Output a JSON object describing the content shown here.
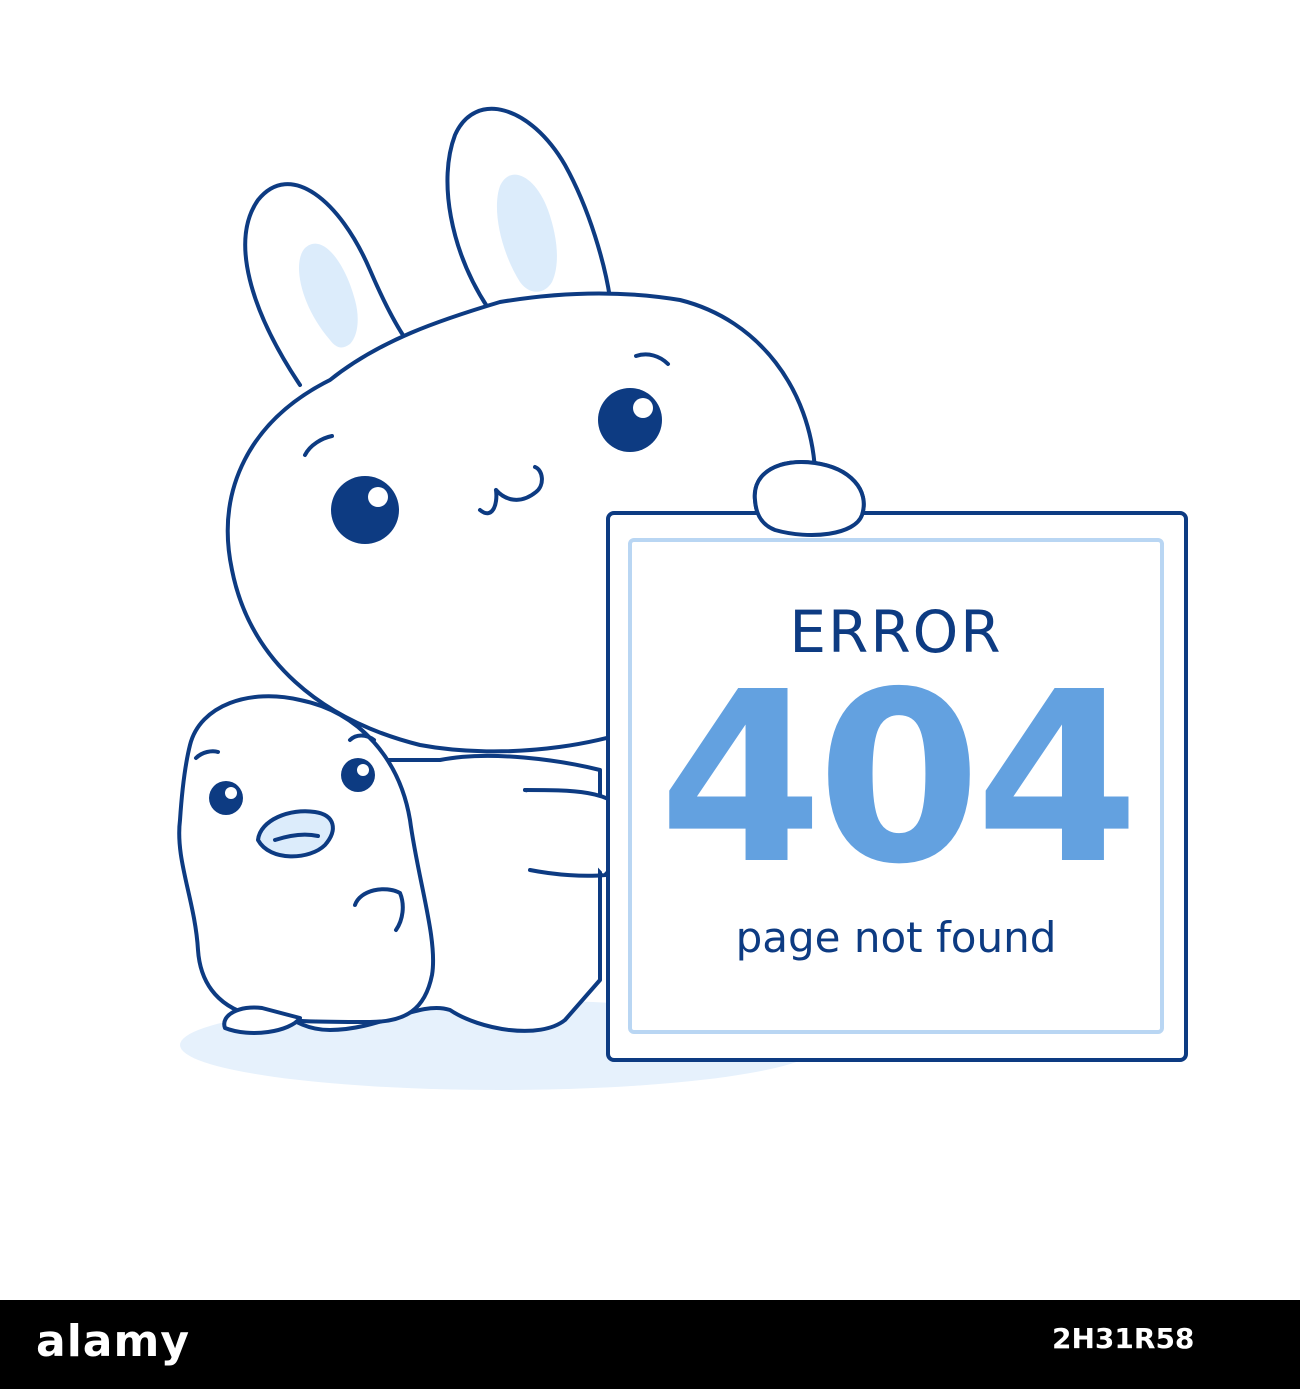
{
  "sign": {
    "title": "ERROR",
    "code": "404",
    "subtitle": "page not found"
  },
  "footer": {
    "logo_text": "alamy",
    "image_code": "2H31R58"
  },
  "colors": {
    "outline": "#0d3b82",
    "accent": "#63a1e0",
    "light_fill": "#dcecfb",
    "background": "#ffffff",
    "footer_bar": "#000000"
  },
  "icons": [
    "bunny-illustration",
    "duckling-illustration",
    "error-sign"
  ]
}
